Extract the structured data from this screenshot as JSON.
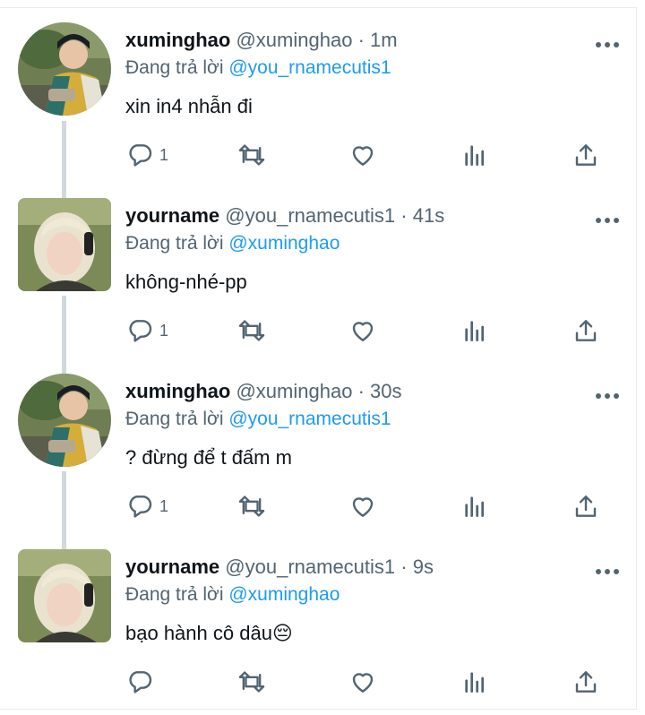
{
  "replying_prefix": "Đang trả lời",
  "tweets": [
    {
      "name": "xuminghao",
      "handle": "@xuminghao",
      "dot": "·",
      "time": "1m",
      "reply_to": "@you_rnamecutis1",
      "text": "xin in4 nhẫn đi",
      "reply_count": "1",
      "avatar": "xuminghao-avatar"
    },
    {
      "name": "yourname",
      "handle": "@you_rnamecutis1",
      "dot": "·",
      "time": "41s",
      "reply_to": "@xuminghao",
      "text": "không-nhé-pp",
      "reply_count": "1",
      "avatar": "yourname-avatar"
    },
    {
      "name": "xuminghao",
      "handle": "@xuminghao",
      "dot": "·",
      "time": "30s",
      "reply_to": "@you_rnamecutis1",
      "text": "? đừng để t đấm m",
      "reply_count": "1",
      "avatar": "xuminghao-avatar"
    },
    {
      "name": "yourname",
      "handle": "@you_rnamecutis1",
      "dot": "·",
      "time": "9s",
      "reply_to": "@xuminghao",
      "text": "bạo hành cô dâu😔",
      "reply_count": "",
      "avatar": "yourname-avatar"
    }
  ],
  "colors": {
    "link": "#1d9bf0",
    "secondary_text": "#536471",
    "primary_text": "#0f1419",
    "thread_line": "#cfd9de",
    "icon": "#536471"
  },
  "icons": {
    "reply": "reply-icon",
    "retweet": "retweet-icon",
    "like": "heart-icon",
    "views": "views-icon",
    "share": "share-icon",
    "more": "more-icon"
  }
}
